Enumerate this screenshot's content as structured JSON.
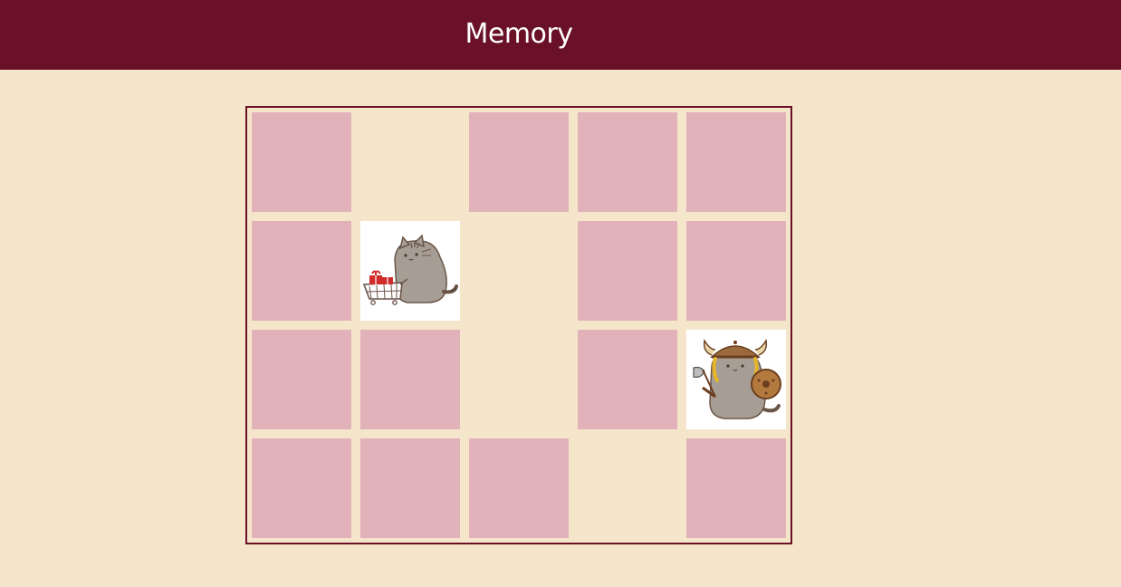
{
  "app": {
    "title": "Memory"
  },
  "colors": {
    "header": "#6a1027",
    "background": "#f5e6cb",
    "card_back": "#e1b2b9",
    "card_face": "#ffffff",
    "board_border": "#6a1027"
  },
  "board": {
    "rows": 4,
    "cols": 5,
    "cards": [
      {
        "state": "hidden"
      },
      {
        "state": "matched"
      },
      {
        "state": "hidden"
      },
      {
        "state": "hidden"
      },
      {
        "state": "hidden"
      },
      {
        "state": "hidden"
      },
      {
        "state": "revealed",
        "icon": "pusheen-shopping-cart-icon"
      },
      {
        "state": "matched"
      },
      {
        "state": "hidden"
      },
      {
        "state": "hidden"
      },
      {
        "state": "hidden"
      },
      {
        "state": "hidden"
      },
      {
        "state": "matched"
      },
      {
        "state": "hidden"
      },
      {
        "state": "revealed",
        "icon": "pusheen-viking-icon"
      },
      {
        "state": "hidden"
      },
      {
        "state": "hidden"
      },
      {
        "state": "hidden"
      },
      {
        "state": "matched"
      },
      {
        "state": "hidden"
      }
    ]
  }
}
